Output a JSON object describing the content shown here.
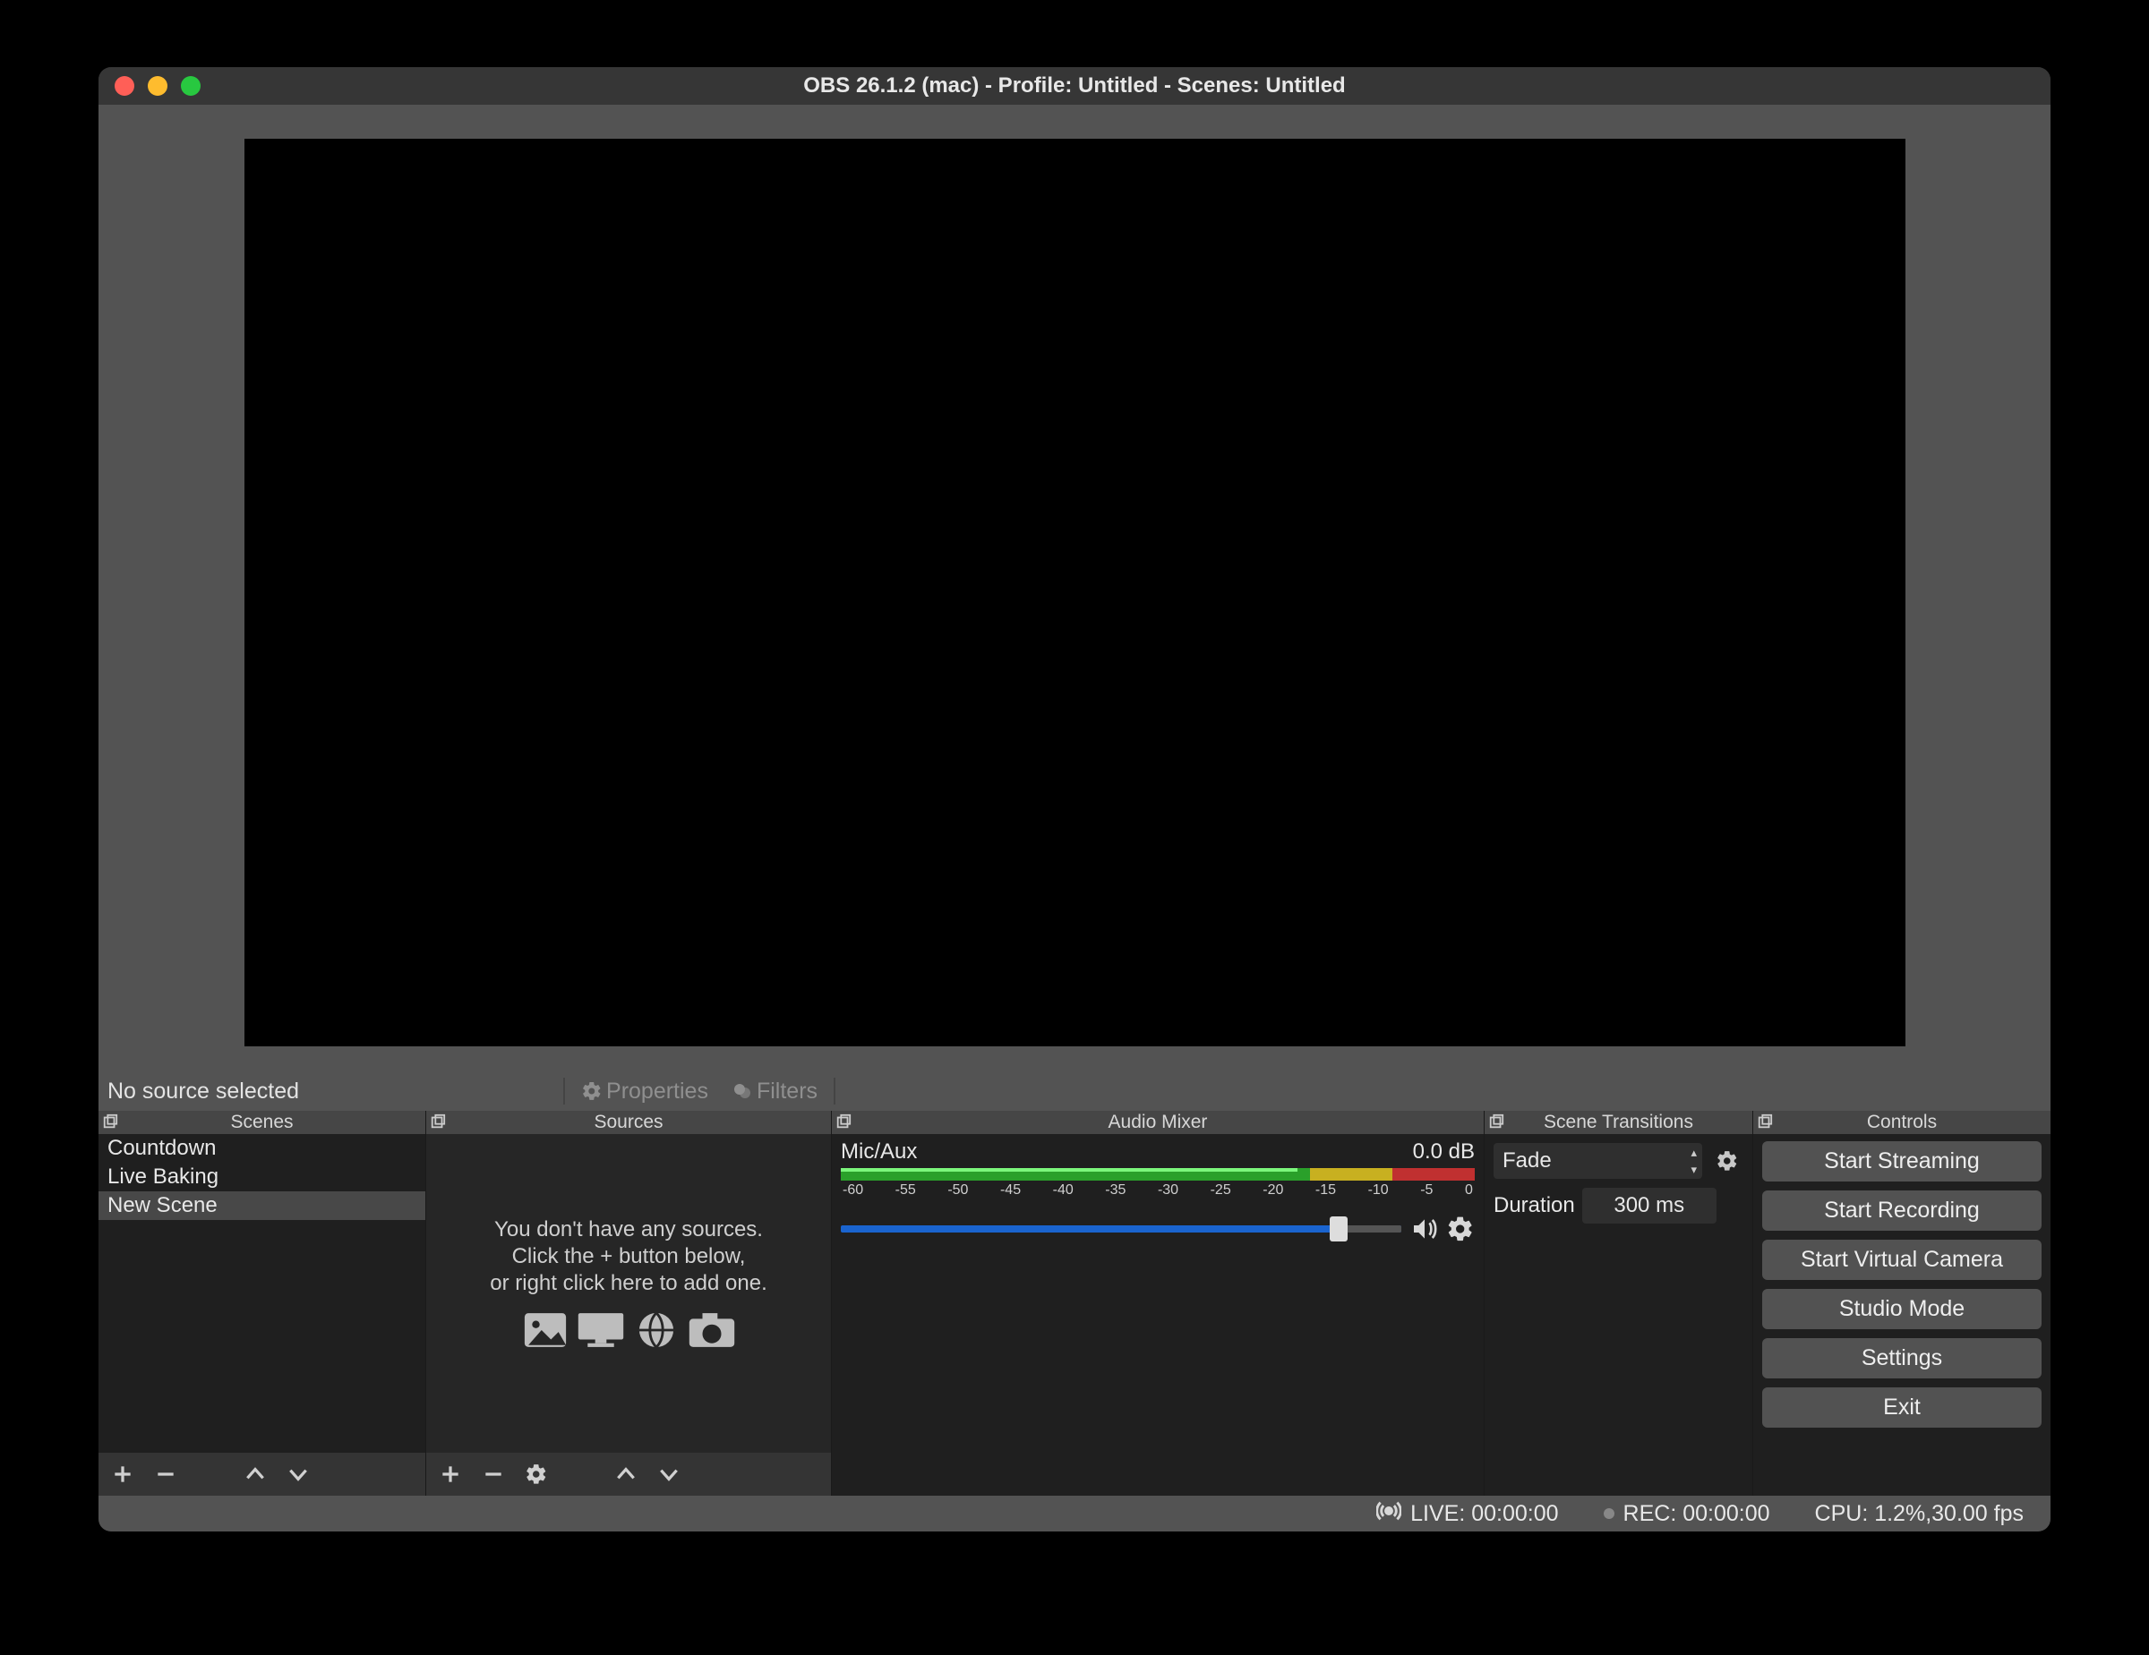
{
  "window": {
    "title": "OBS 26.1.2 (mac) - Profile: Untitled - Scenes: Untitled"
  },
  "source_bar": {
    "no_source": "No source selected",
    "properties": "Properties",
    "filters": "Filters"
  },
  "docks": {
    "scenes": {
      "title": "Scenes",
      "items": [
        "Countdown",
        "Live Baking",
        "New Scene"
      ],
      "selected_index": 2
    },
    "sources": {
      "title": "Sources",
      "empty_line1": "You don't have any sources.",
      "empty_line2": "Click the + button below,",
      "empty_line3": "or right click here to add one."
    },
    "mixer": {
      "title": "Audio Mixer",
      "channel_name": "Mic/Aux",
      "db": "0.0 dB",
      "ticks": [
        "-60",
        "-55",
        "-50",
        "-45",
        "-40",
        "-35",
        "-30",
        "-25",
        "-20",
        "-15",
        "-10",
        "-5",
        "0"
      ]
    },
    "transitions": {
      "title": "Scene Transitions",
      "selected": "Fade",
      "duration_label": "Duration",
      "duration_value": "300 ms"
    },
    "controls": {
      "title": "Controls",
      "buttons": [
        "Start Streaming",
        "Start Recording",
        "Start Virtual Camera",
        "Studio Mode",
        "Settings",
        "Exit"
      ]
    }
  },
  "status": {
    "live": "LIVE: 00:00:00",
    "rec": "REC: 00:00:00",
    "cpu": "CPU: 1.2%,30.00 fps"
  }
}
